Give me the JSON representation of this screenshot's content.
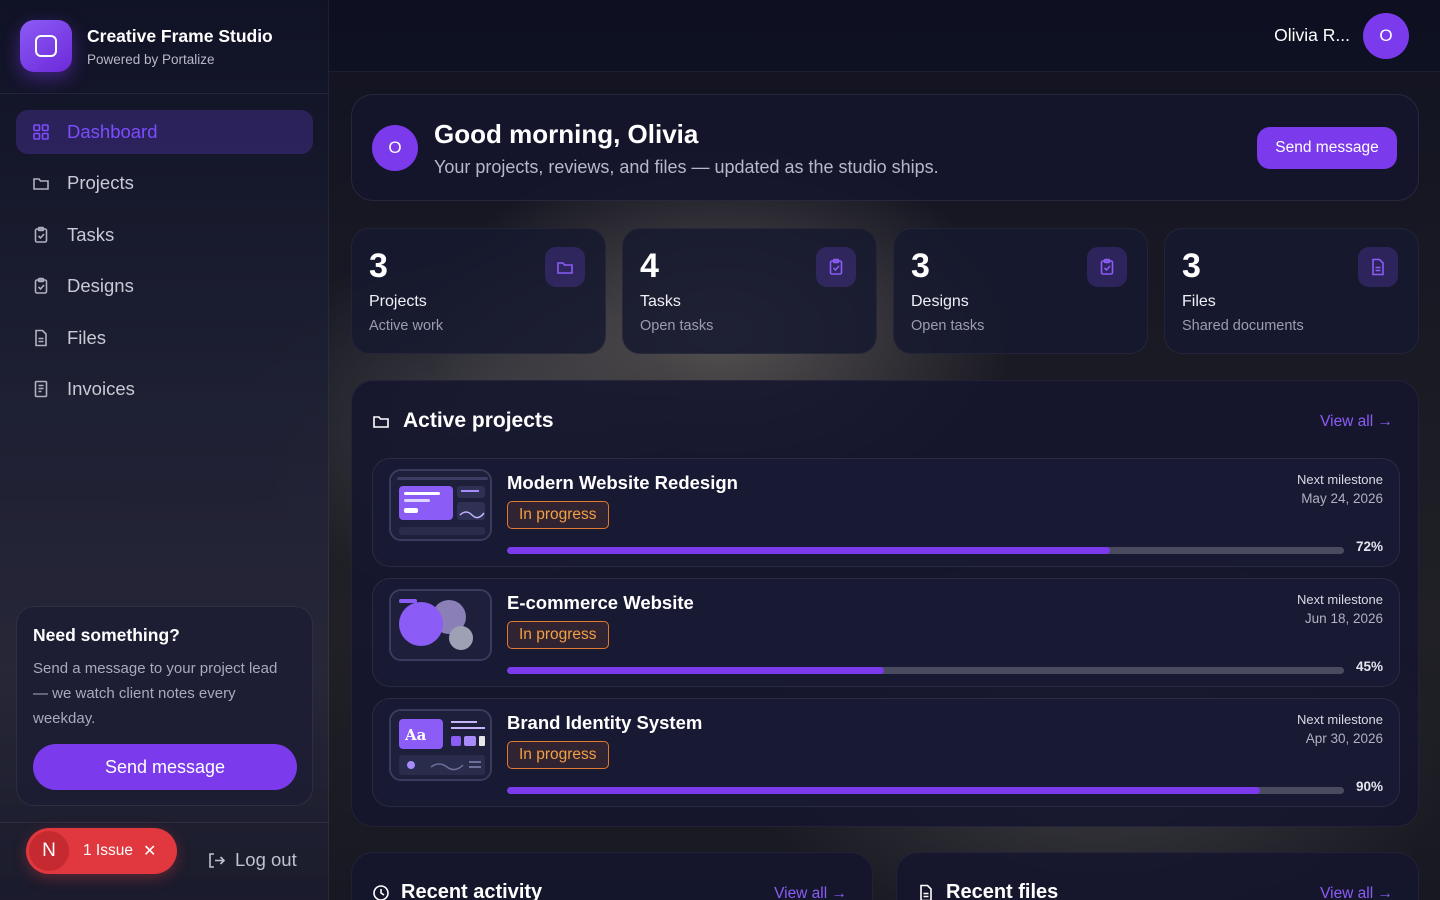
{
  "brand": {
    "title": "Creative Frame Studio",
    "subtitle": "Powered by Portalize"
  },
  "nav": [
    {
      "label": "Dashboard",
      "icon": "grid-icon",
      "active": true
    },
    {
      "label": "Projects",
      "icon": "folder-icon"
    },
    {
      "label": "Tasks",
      "icon": "clipboard-icon"
    },
    {
      "label": "Designs",
      "icon": "clipboard-icon"
    },
    {
      "label": "Files",
      "icon": "file-icon"
    },
    {
      "label": "Invoices",
      "icon": "receipt-icon"
    }
  ],
  "help": {
    "title": "Need something?",
    "text": "Send a message to your project lead — we watch client notes every weekday.",
    "button": "Send message"
  },
  "issue": {
    "avatar": "N",
    "label": "1 Issue"
  },
  "logout": "Log out",
  "user": {
    "name": "Olivia R...",
    "initial": "O"
  },
  "greeting": {
    "initial": "O",
    "title": "Good morning, Olivia",
    "subtitle": "Your projects, reviews, and files — updated as the studio ships.",
    "button": "Send message"
  },
  "stats": [
    {
      "value": "3",
      "label": "Projects",
      "sub": "Active work",
      "icon": "folder-icon"
    },
    {
      "value": "4",
      "label": "Tasks",
      "sub": "Open tasks",
      "icon": "clipboard-icon"
    },
    {
      "value": "3",
      "label": "Designs",
      "sub": "Open tasks",
      "icon": "clipboard-icon"
    },
    {
      "value": "3",
      "label": "Files",
      "sub": "Shared documents",
      "icon": "file-icon"
    }
  ],
  "projects": {
    "title": "Active projects",
    "view_all": "View all →",
    "items": [
      {
        "name": "Modern Website Redesign",
        "status": "In progress",
        "milestone_label": "Next milestone",
        "milestone_date": "May 24, 2026",
        "progress": 72,
        "progress_text": "72%"
      },
      {
        "name": "E-commerce Website",
        "status": "In progress",
        "milestone_label": "Next milestone",
        "milestone_date": "Jun 18, 2026",
        "progress": 45,
        "progress_text": "45%"
      },
      {
        "name": "Brand Identity System",
        "status": "In progress",
        "milestone_label": "Next milestone",
        "milestone_date": "Apr 30, 2026",
        "progress": 90,
        "progress_text": "90%"
      }
    ]
  },
  "recent_activity": {
    "title": "Recent activity",
    "view_all": "View all →"
  },
  "recent_files": {
    "title": "Recent files",
    "view_all": "View all →"
  },
  "colors": {
    "accent": "#7c3aed",
    "badge": "#f59e42",
    "issue": "#e0383e"
  }
}
